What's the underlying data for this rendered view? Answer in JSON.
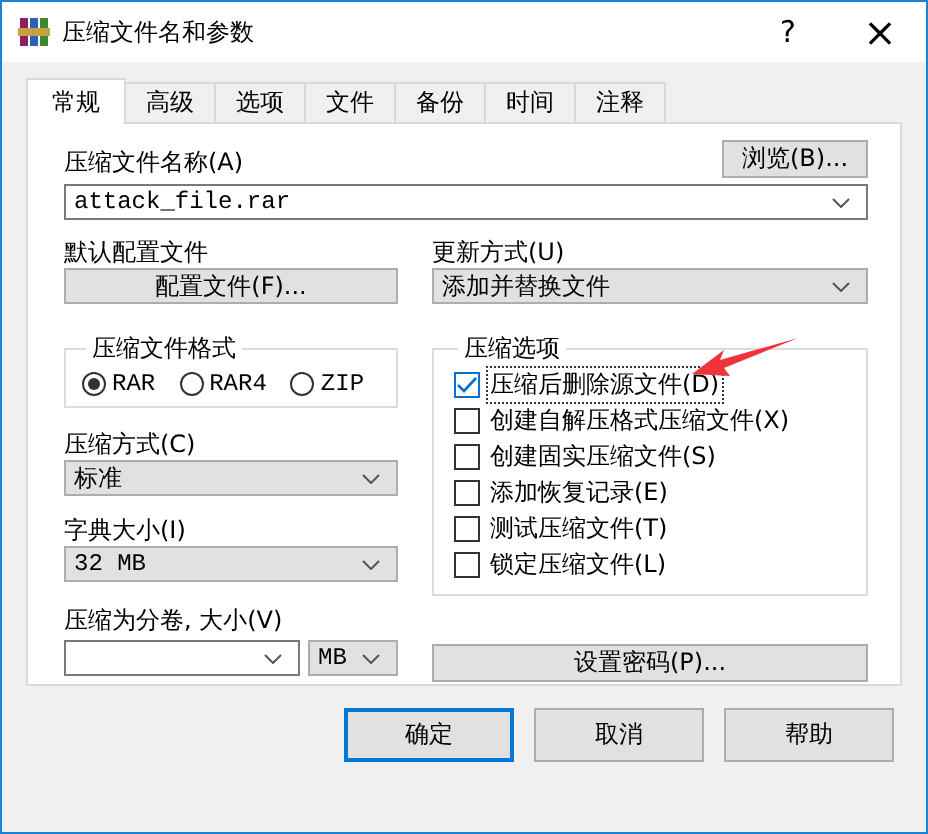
{
  "window": {
    "title": "压缩文件名和参数",
    "help_button": "?",
    "close_button": "×"
  },
  "tabs": [
    {
      "label": "常规",
      "selected": true
    },
    {
      "label": "高级",
      "selected": false
    },
    {
      "label": "选项",
      "selected": false
    },
    {
      "label": "文件",
      "selected": false
    },
    {
      "label": "备份",
      "selected": false
    },
    {
      "label": "时间",
      "selected": false
    },
    {
      "label": "注释",
      "selected": false
    }
  ],
  "archive_name": {
    "label": "压缩文件名称(A)",
    "browse_button": "浏览(B)...",
    "value": "attack_file.rar"
  },
  "profile": {
    "label": "默认配置文件",
    "button": "配置文件(F)..."
  },
  "update_mode": {
    "label": "更新方式(U)",
    "value": "添加并替换文件"
  },
  "archive_format": {
    "title": "压缩文件格式",
    "options": [
      {
        "label": "RAR",
        "selected": true
      },
      {
        "label": "RAR4",
        "selected": false
      },
      {
        "label": "ZIP",
        "selected": false
      }
    ]
  },
  "compression_method": {
    "label": "压缩方式(C)",
    "value": "标准"
  },
  "dictionary_size": {
    "label": "字典大小(I)",
    "value": "32 MB"
  },
  "split": {
    "label": "压缩为分卷, 大小(V)",
    "unit": "MB"
  },
  "archive_options": {
    "title": "压缩选项",
    "options": [
      {
        "label": "压缩后删除源文件(D)",
        "checked": true
      },
      {
        "label": "创建自解压格式压缩文件(X)",
        "checked": false
      },
      {
        "label": "创建固实压缩文件(S)",
        "checked": false
      },
      {
        "label": "添加恢复记录(E)",
        "checked": false
      },
      {
        "label": "测试压缩文件(T)",
        "checked": false
      },
      {
        "label": "锁定压缩文件(L)",
        "checked": false
      }
    ]
  },
  "password_button": "设置密码(P)...",
  "buttons": [
    {
      "label": "确定",
      "default": true
    },
    {
      "label": "取消",
      "default": false
    },
    {
      "label": "帮助",
      "default": false
    }
  ]
}
